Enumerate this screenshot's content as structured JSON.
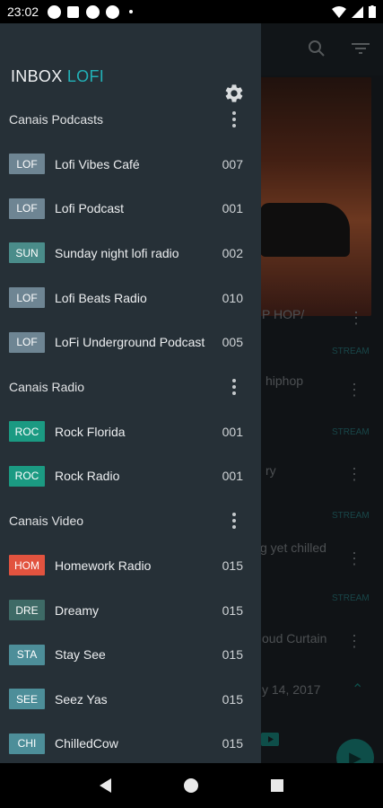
{
  "status_bar": {
    "time": "23:02"
  },
  "background": {
    "items": [
      {
        "title": "P HOP/",
        "tag": "STREAM"
      },
      {
        "title": "hiphop",
        "tag": "STREAM"
      },
      {
        "title": "ry",
        "tag": "STREAM"
      },
      {
        "title": "g yet chilled",
        "tag": "STREAM"
      },
      {
        "title": "oud Curtain",
        "tag": ""
      }
    ],
    "date_text": "y 14, 2017"
  },
  "drawer": {
    "brand": {
      "prefix": "INBOX",
      "accent": "LOFI"
    },
    "sections": [
      {
        "label": "Canais Podcasts",
        "items": [
          {
            "badge": "LOF",
            "badge_color": "#6e8593",
            "label": "Lofi Vibes Café",
            "count": "007"
          },
          {
            "badge": "LOF",
            "badge_color": "#6e8593",
            "label": "Lofi Podcast",
            "count": "001"
          },
          {
            "badge": "SUN",
            "badge_color": "#4a8c8a",
            "label": "Sunday night lofi radio",
            "count": "002"
          },
          {
            "badge": "LOF",
            "badge_color": "#6e8593",
            "label": "Lofi Beats Radio",
            "count": "010"
          },
          {
            "badge": "LOF",
            "badge_color": "#6e8593",
            "label": "LoFi Underground Podcast",
            "count": "005"
          }
        ]
      },
      {
        "label": "Canais Radio",
        "items": [
          {
            "badge": "ROC",
            "badge_color": "#1b9a82",
            "label": "Rock Florida",
            "count": "001"
          },
          {
            "badge": "ROC",
            "badge_color": "#1b9a82",
            "label": "Rock Radio",
            "count": "001"
          }
        ]
      },
      {
        "label": "Canais Video",
        "items": [
          {
            "badge": "HOM",
            "badge_color": "#e2533f",
            "label": "Homework Radio",
            "count": "015"
          },
          {
            "badge": "DRE",
            "badge_color": "#3e6a66",
            "label": "Dreamy",
            "count": "015"
          },
          {
            "badge": "STA",
            "badge_color": "#4d8e99",
            "label": "Stay See",
            "count": "015"
          },
          {
            "badge": "SEE",
            "badge_color": "#4d8e99",
            "label": "Seez Yas",
            "count": "015"
          },
          {
            "badge": "CHI",
            "badge_color": "#4d8e99",
            "label": "ChilledCow",
            "count": "015"
          }
        ]
      }
    ]
  }
}
